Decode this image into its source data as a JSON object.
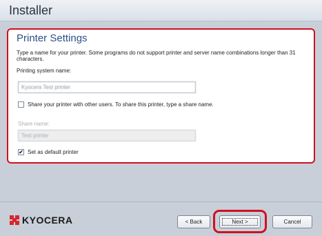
{
  "window": {
    "title": "Installer"
  },
  "section": {
    "title": "Printer Settings",
    "description": "Type a name for your printer. Some programs do not support printer and server name combinations longer than 31 characters."
  },
  "printing_system": {
    "label": "Printing system name:",
    "value": "Kyocera Test printer"
  },
  "share": {
    "checkbox_label": "Share your printer with other users. To share this printer, type a share name.",
    "checked": false,
    "name_label": "Share name:",
    "name_value": "Test printer"
  },
  "default_printer": {
    "checkbox_label": "Set as default printer",
    "checked": true
  },
  "branding": {
    "logo_text": "KYOCERA",
    "logo_color": "#d8262e"
  },
  "buttons": {
    "back": "< Back",
    "next": "Next >",
    "cancel": "Cancel"
  },
  "highlight_color": "#d20f1e"
}
